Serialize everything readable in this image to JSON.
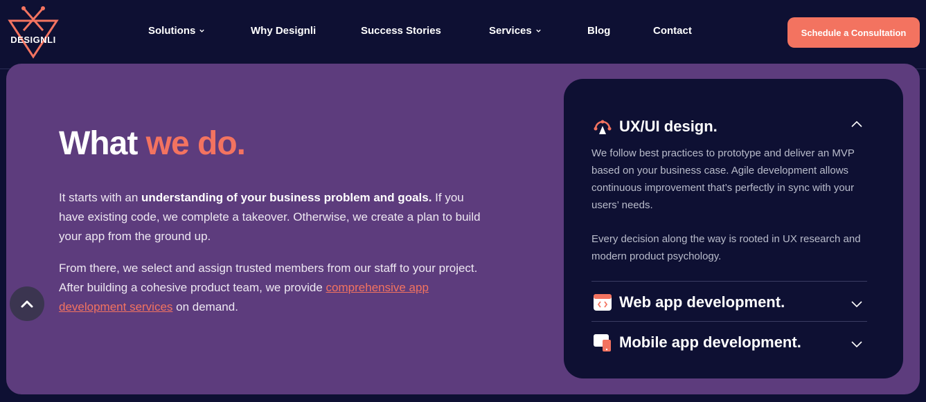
{
  "header": {
    "logo_text": "DESIGNLI",
    "nav": [
      {
        "label": "Solutions",
        "has_dropdown": true
      },
      {
        "label": "Why Designli",
        "has_dropdown": false
      },
      {
        "label": "Success Stories",
        "has_dropdown": false
      },
      {
        "label": "Services",
        "has_dropdown": true
      },
      {
        "label": "Blog",
        "has_dropdown": false
      },
      {
        "label": "Contact",
        "has_dropdown": false
      }
    ],
    "cta_label": "Schedule a Consultation"
  },
  "main": {
    "headline_part1": "What ",
    "headline_part2": "we do.",
    "para1_intro": "It starts with an ",
    "para1_bold": "understanding of your business problem and goals.",
    "para1_rest": " If you have existing code, we complete a takeover. Otherwise, we create a plan to build your app from the ground up.",
    "para2_intro": "From there, we select and assign trusted members from our staff to your project. After building a cohesive product team, we provide ",
    "para2_link": "comprehensive app development services",
    "para2_rest": " on demand."
  },
  "accordion": [
    {
      "title": "UX/UI design.",
      "icon": "ux-ui-icon",
      "expanded": true,
      "body1": "We follow best practices to prototype and deliver an MVP based on your business case. Agile development allows continuous improvement that’s perfectly in sync with your users’ needs.",
      "body2": "Every decision along the way is rooted in UX research and modern product psychology."
    },
    {
      "title": "Web app development.",
      "icon": "web-app-icon",
      "expanded": false
    },
    {
      "title": "Mobile app development.",
      "icon": "mobile-app-icon",
      "expanded": false
    }
  ],
  "colors": {
    "navy": "#0e1033",
    "purple": "#5d3c7d",
    "accent": "#f37360"
  }
}
